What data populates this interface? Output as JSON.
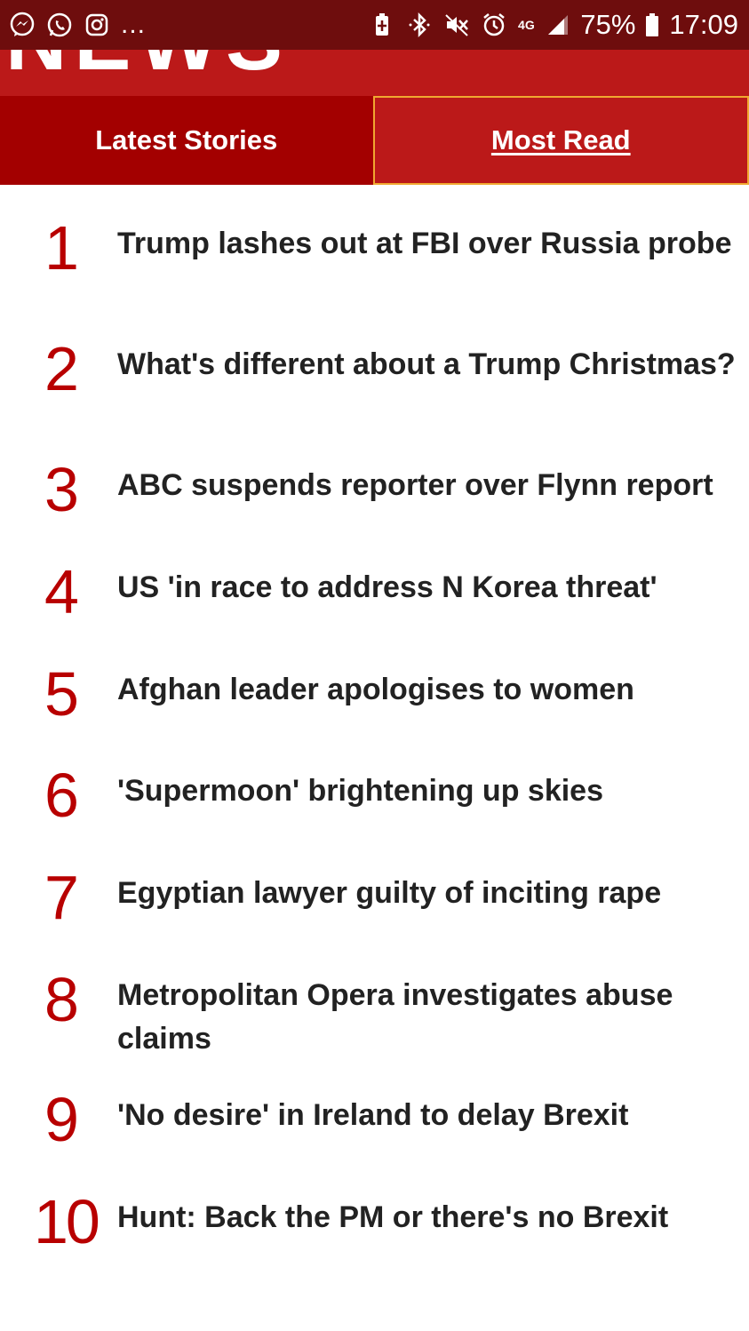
{
  "status_bar": {
    "icons_left": [
      "messenger-icon",
      "whatsapp-icon",
      "instagram-icon"
    ],
    "more": "...",
    "icons_right": [
      "battery-saver-icon",
      "bluetooth-icon",
      "mute-icon",
      "alarm-icon"
    ],
    "network": "4G",
    "battery": "75%",
    "time": "17:09"
  },
  "brand": {
    "word": "NEWS",
    "color": "#bb1919"
  },
  "tabs": [
    {
      "label": "Latest Stories",
      "active": false
    },
    {
      "label": "Most Read",
      "active": true
    }
  ],
  "stories": [
    {
      "rank": "1",
      "title": "Trump lashes out at FBI over Russia probe"
    },
    {
      "rank": "2",
      "title": "What's different about a Trump Christmas?"
    },
    {
      "rank": "3",
      "title": "ABC suspends reporter over Flynn report"
    },
    {
      "rank": "4",
      "title": "US 'in race to address N Korea threat'"
    },
    {
      "rank": "5",
      "title": "Afghan leader apologises to women"
    },
    {
      "rank": "6",
      "title": "'Supermoon' brightening up skies"
    },
    {
      "rank": "7",
      "title": "Egyptian lawyer guilty of inciting rape"
    },
    {
      "rank": "8",
      "title": "Metropolitan Opera investigates abuse claims"
    },
    {
      "rank": "9",
      "title": "'No desire' in Ireland to delay Brexit"
    },
    {
      "rank": "10",
      "title": "Hunt: Back the PM or there's no Brexit"
    }
  ]
}
